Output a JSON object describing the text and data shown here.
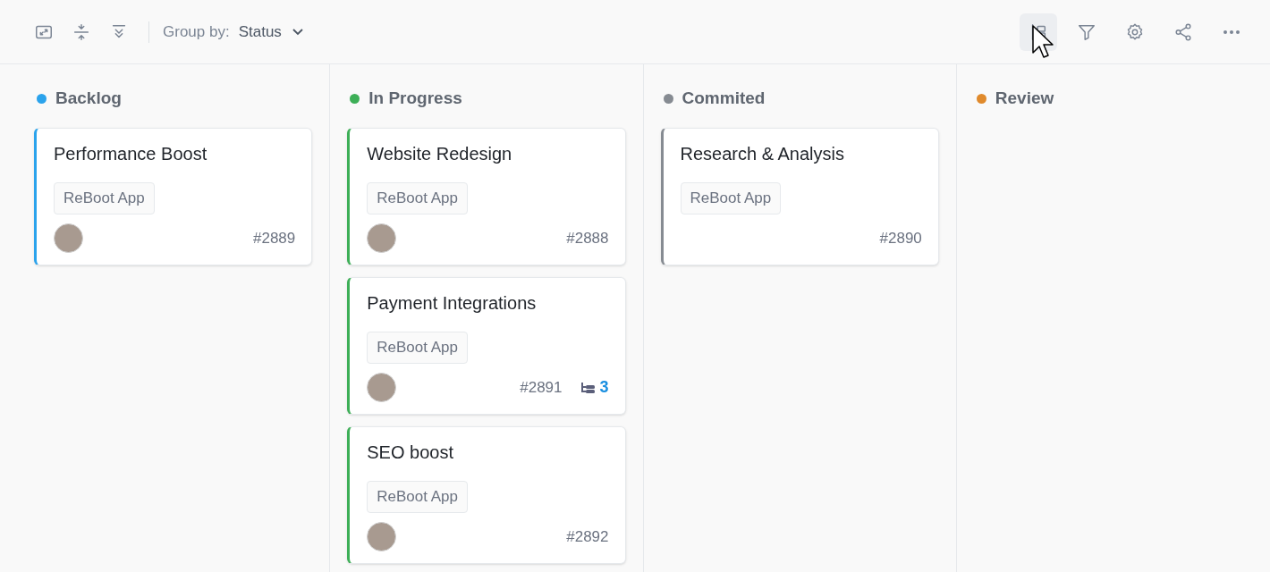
{
  "toolbar": {
    "group_by": {
      "label": "Group by:",
      "value": "Status"
    },
    "right_icons": [
      {
        "highlighted": true
      },
      {
        "highlighted": false
      },
      {
        "highlighted": false
      },
      {
        "highlighted": false
      },
      {
        "highlighted": false
      }
    ]
  },
  "columns": [
    {
      "title": "Backlog",
      "color": "#2ba3ec",
      "cards": [
        {
          "title": "Performance Boost",
          "tag": "ReBoot App",
          "id": "#2889",
          "avatar": true
        }
      ]
    },
    {
      "title": "In Progress",
      "color": "#3daf57",
      "cards": [
        {
          "title": "Website Redesign",
          "tag": "ReBoot App",
          "id": "#2888",
          "avatar": true
        },
        {
          "title": "Payment Integrations",
          "tag": "ReBoot App",
          "id": "#2891",
          "avatar": true,
          "subtasks": "3"
        },
        {
          "title": "SEO boost",
          "tag": "ReBoot App",
          "id": "#2892",
          "avatar": true
        }
      ]
    },
    {
      "title": "Commited",
      "color": "#868b92",
      "cards": [
        {
          "title": "Research & Analysis",
          "tag": "ReBoot App",
          "id": "#2890",
          "avatar": false
        }
      ]
    },
    {
      "title": "Review",
      "color": "#e08a2c"
    }
  ]
}
